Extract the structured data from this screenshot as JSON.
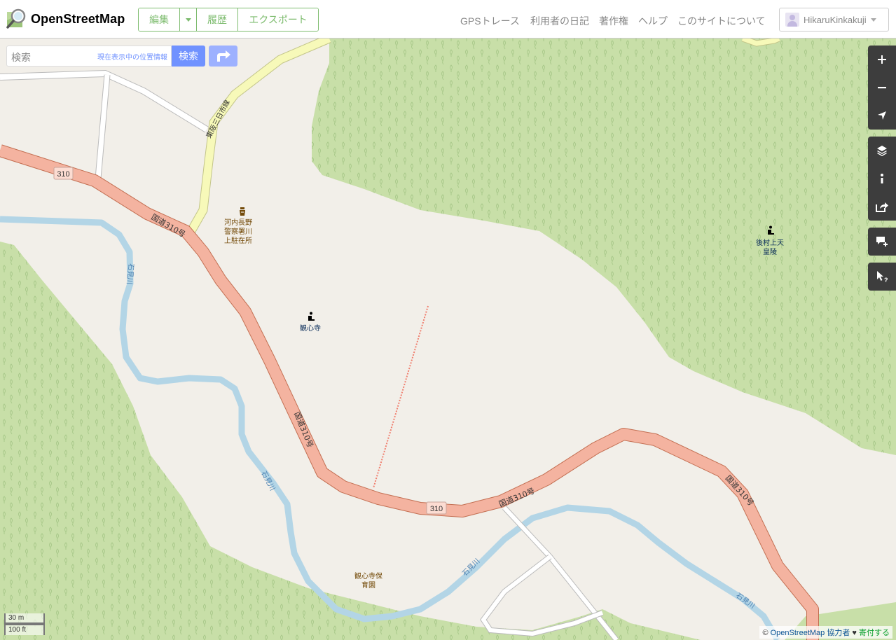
{
  "header": {
    "logo_text": "OpenStreetMap",
    "edit_label": "編集",
    "history_label": "履歴",
    "export_label": "エクスポート",
    "nav": {
      "gps": "GPSトレース",
      "diary": "利用者の日記",
      "copyright": "著作権",
      "help": "ヘルプ",
      "about": "このサイトについて"
    },
    "user_name": "HikaruKinkakuji"
  },
  "search": {
    "placeholder": "検索",
    "where_am_i": "現在表示中の位置情報",
    "button": "検索"
  },
  "map": {
    "labels": {
      "road_shield_1": "310",
      "road_shield_2": "310",
      "road_name_1": "国道310号",
      "road_name_2": "国道310号",
      "road_name_3": "国道310号",
      "road_name_4": "国道310号",
      "yellow_road": "東阪三日市線",
      "river_1": "石見川",
      "river_2": "石見川",
      "river_3": "石見川",
      "river_4": "石見川",
      "police_1": "河内長野",
      "police_2": "警察署川",
      "police_3": "上駐在所",
      "temple": "観心寺",
      "tomb_1": "後村上天",
      "tomb_2": "皇陵",
      "nursery_1": "観心寺保",
      "nursery_2": "育園"
    },
    "colors": {
      "land": "#f2efe9",
      "forest": "#c8dfa8",
      "primary_road": "#f4b3a0",
      "secondary_road": "#f7f9b9",
      "river": "#b3d5e6",
      "label_brown": "#734a08",
      "label_blue": "#0a2d5a"
    }
  },
  "scale": {
    "metric": "30 m",
    "imperial": "100 ft"
  },
  "attribution": {
    "copyright": "©",
    "osm": "OpenStreetMap",
    "contributors": "協力者",
    "heart": "♥",
    "donate": "寄付する"
  },
  "controls": {
    "zoom_in": "plus-icon",
    "zoom_out": "minus-icon",
    "locate": "location-arrow-icon",
    "layers": "layers-icon",
    "info": "info-icon",
    "share": "share-icon",
    "note": "add-note-icon",
    "query": "query-features-icon"
  }
}
